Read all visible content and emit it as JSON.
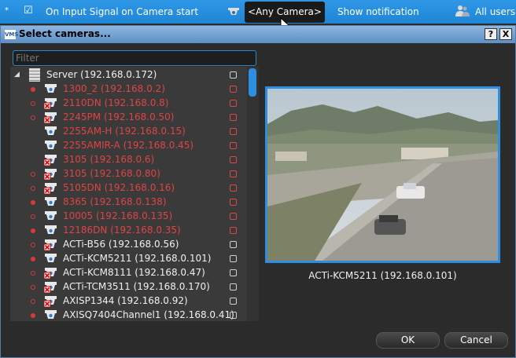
{
  "rulebar": {
    "star": "*",
    "check": "☑",
    "event": "On Input Signal on Camera start",
    "camera_selector": "<Any Camera>",
    "action": "Show notification",
    "users": "All users"
  },
  "dialog": {
    "app_icon_text": "VMS",
    "title": "Select cameras...",
    "help": "?",
    "close": "X"
  },
  "filter": {
    "placeholder": "Filter"
  },
  "tree": {
    "server": "Server (192.168.0.172)",
    "cameras": [
      {
        "label": "1300_2 (192.168.0.2)",
        "status": "bad",
        "dot": "full",
        "icon": "dome-camera-icon"
      },
      {
        "label": "2110DN (192.168.0.8)",
        "status": "bad",
        "dot": "ring",
        "icon": "camera-error-icon"
      },
      {
        "label": "2245PM (192.168.0.50)",
        "status": "bad",
        "dot": "ring",
        "icon": "camera-error-icon"
      },
      {
        "label": "2255AM-H (192.168.0.15)",
        "status": "bad",
        "dot": "none",
        "icon": "dome-camera-icon"
      },
      {
        "label": "2255AMIR-A (192.168.0.45)",
        "status": "bad",
        "dot": "none",
        "icon": "dome-camera-icon"
      },
      {
        "label": "3105 (192.168.0.6)",
        "status": "bad",
        "dot": "none",
        "icon": "camera-error-icon"
      },
      {
        "label": "3105 (192.168.0.80)",
        "status": "bad",
        "dot": "ring",
        "icon": "camera-error-icon"
      },
      {
        "label": "5105DN (192.168.0.16)",
        "status": "bad",
        "dot": "ring",
        "icon": "camera-error-icon"
      },
      {
        "label": "8365 (192.168.0.138)",
        "status": "bad",
        "dot": "full",
        "icon": "dome-camera-icon"
      },
      {
        "label": "10005 (192.168.0.135)",
        "status": "bad",
        "dot": "ring",
        "icon": "dome-camera-icon"
      },
      {
        "label": "12186DN (192.168.0.35)",
        "status": "bad",
        "dot": "full",
        "icon": "dome-camera-icon"
      },
      {
        "label": "ACTi-B56 (192.168.0.56)",
        "status": "ok",
        "dot": "ring",
        "icon": "camera-error-icon"
      },
      {
        "label": "ACTi-KCM5211 (192.168.0.101)",
        "status": "ok",
        "dot": "full",
        "icon": "dome-camera-icon"
      },
      {
        "label": "ACTi-KCM8111 (192.168.0.47)",
        "status": "ok",
        "dot": "ring",
        "icon": "camera-error-icon"
      },
      {
        "label": "ACTi-TCM3511 (192.168.0.170)",
        "status": "ok",
        "dot": "ring",
        "icon": "camera-error-icon"
      },
      {
        "label": "AXISP1344 (192.168.0.92)",
        "status": "ok",
        "dot": "ring",
        "icon": "camera-error-icon"
      },
      {
        "label": "AXISQ7404Channel1 (192.168.0.41)",
        "status": "ok",
        "dot": "full",
        "icon": "dome-camera-icon"
      }
    ]
  },
  "preview": {
    "caption": "ACTi-KCM5211 (192.168.0.101)"
  },
  "buttons": {
    "ok": "OK",
    "cancel": "Cancel"
  }
}
